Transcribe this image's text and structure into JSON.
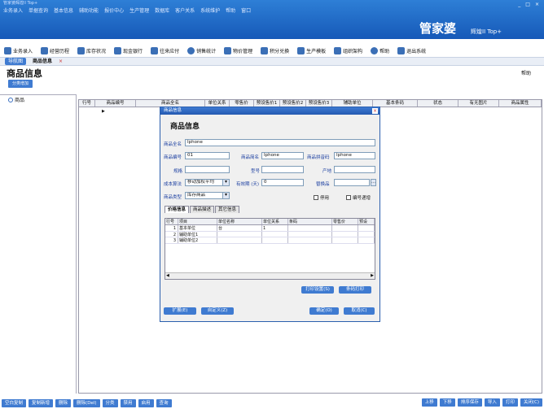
{
  "titlebar": {
    "caption": "管家婆辉煌II Top+",
    "menus": [
      "业务录入",
      "单据查询",
      "基本信息",
      "辅助功能",
      "报价中心",
      "生产管理",
      "数据库",
      "客户关系",
      "系统维护",
      "帮助",
      "窗口"
    ],
    "window_controls": [
      "_",
      "□",
      "×"
    ]
  },
  "logo": {
    "brand": "管家婆",
    "edition": "辉煌II Top+"
  },
  "toolbar": {
    "items": [
      {
        "label": "业务录入",
        "icon": "edit-icon"
      },
      {
        "label": "经营历程",
        "icon": "chart-icon"
      },
      {
        "label": "库存状况",
        "icon": "box-icon"
      },
      {
        "label": "现金银行",
        "icon": "bank-icon"
      },
      {
        "label": "往来应付",
        "icon": "money-icon"
      },
      {
        "label": "销售统计",
        "icon": "globe-icon"
      },
      {
        "label": "物价管理",
        "icon": "tag-icon"
      },
      {
        "label": "积分兑换",
        "icon": "gift-icon"
      },
      {
        "label": "生产模板",
        "icon": "tools-icon"
      },
      {
        "label": "组织架构",
        "icon": "org-icon"
      },
      {
        "label": "帮助",
        "icon": "info-icon"
      },
      {
        "label": "退出系统",
        "icon": "exit-icon"
      }
    ]
  },
  "tabs": {
    "home": "导航图",
    "current": "商品信息",
    "close": "×"
  },
  "page": {
    "title": "商品信息",
    "help": "帮助",
    "add_category": "分类增加"
  },
  "tree": {
    "root": "商品"
  },
  "grid": {
    "columns": [
      "行号",
      "商品编号",
      "商品全名",
      "单位关系",
      "零售价",
      "预设售价1",
      "预设售价2",
      "预设售价3",
      "辅助单位",
      "基本条码",
      "状态",
      "有无图片",
      "商品属性"
    ]
  },
  "bottombar": {
    "left": [
      "空白复制",
      "复制新增",
      "删除",
      "删除(Del)",
      "分类",
      "禁用",
      "启用",
      "查询"
    ],
    "right": [
      "上移",
      "下移",
      "排序保存",
      "导入",
      "打印",
      "关闭(C)"
    ]
  },
  "dialog": {
    "window_title": "商品信息",
    "heading": "商品信息",
    "close": "×",
    "fields": {
      "full_name": {
        "label": "商品全名",
        "value": "Iphone"
      },
      "code": {
        "label": "商品编号",
        "value": "01"
      },
      "short_name": {
        "label": "商品简名",
        "value": "Iphone"
      },
      "pinyin": {
        "label": "商品拼音码",
        "value": "Iphone"
      },
      "spec": {
        "label": "规格",
        "value": ""
      },
      "model": {
        "label": "型号",
        "value": ""
      },
      "origin": {
        "label": "产地",
        "value": ""
      },
      "cost_method": {
        "label": "成本算法",
        "value": "移动加权平均"
      },
      "shelf_life": {
        "label": "有效期 (天)",
        "value": "0"
      },
      "substitute": {
        "label": "替换品",
        "value": ""
      },
      "goods_type": {
        "label": "商品类型",
        "value": "库存商品"
      }
    },
    "checks": {
      "disabled": "停用",
      "code_inc": "编号递增"
    },
    "tabs": [
      "价格信息",
      "商品描述",
      "其它信息"
    ],
    "price_grid": {
      "columns": [
        "行号",
        "项目",
        "单位名称",
        "单位关系",
        "条码",
        "零售价",
        "预设"
      ],
      "rows": [
        {
          "no": "1",
          "item": "基本单位",
          "unit": "台",
          "ratio": "1",
          "barcode": "",
          "price": ""
        },
        {
          "no": "2",
          "item": "辅助单位1",
          "unit": "",
          "ratio": "",
          "barcode": "",
          "price": ""
        },
        {
          "no": "3",
          "item": "辅助单位2",
          "unit": "",
          "ratio": "",
          "barcode": "",
          "price": ""
        }
      ]
    },
    "buttons": {
      "print_setup": "打印设置(S)",
      "barcode_print": "条码打印",
      "expand": "扩展(E)",
      "custom": "自定义(Z)",
      "ok": "确定(O)",
      "cancel": "取消(C)"
    }
  }
}
